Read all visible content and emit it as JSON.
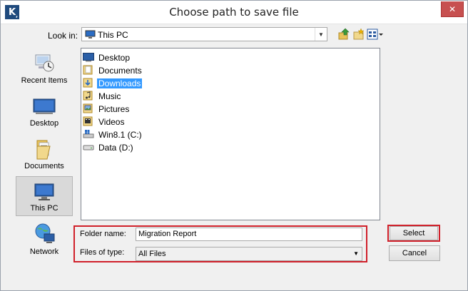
{
  "window": {
    "title": "Choose path to save file",
    "app_badge": "K",
    "close_label": "✕"
  },
  "lookin": {
    "label": "Look in:",
    "value": "This PC"
  },
  "places": [
    {
      "label": "Recent Items"
    },
    {
      "label": "Desktop"
    },
    {
      "label": "Documents"
    },
    {
      "label": "This PC"
    },
    {
      "label": "Network"
    }
  ],
  "files": [
    {
      "name": "Desktop",
      "icon": "desktop-folder-icon"
    },
    {
      "name": "Documents",
      "icon": "documents-folder-icon"
    },
    {
      "name": "Downloads",
      "icon": "downloads-folder-icon"
    },
    {
      "name": "Music",
      "icon": "music-folder-icon"
    },
    {
      "name": "Pictures",
      "icon": "pictures-folder-icon"
    },
    {
      "name": "Videos",
      "icon": "videos-folder-icon"
    },
    {
      "name": "Win8.1 (C:)",
      "icon": "system-drive-icon"
    },
    {
      "name": "Data (D:)",
      "icon": "drive-icon"
    }
  ],
  "form": {
    "folder_label": "Folder name:",
    "folder_value": "Migration Report",
    "type_label": "Files of type:",
    "type_value": "All Files"
  },
  "buttons": {
    "select": "Select",
    "cancel": "Cancel"
  },
  "colors": {
    "highlight": "#d0202a",
    "selection": "#3399ff",
    "close": "#c75050"
  }
}
